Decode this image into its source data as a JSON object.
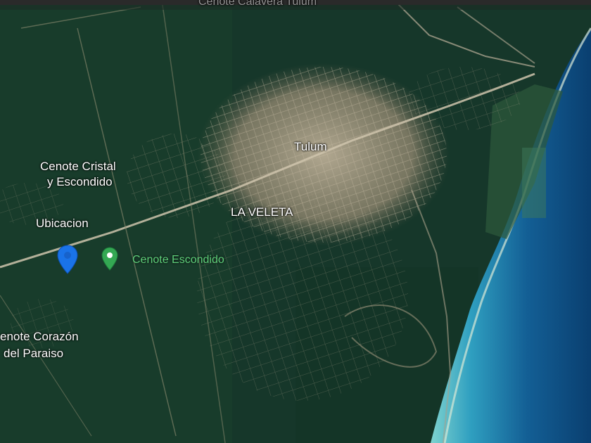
{
  "map": {
    "labels": {
      "top_partial": "Cenote Calavera Tulum",
      "tulum": "Tulum",
      "cenote_cristal_1": "Cenote Cristal",
      "cenote_cristal_2": "y Escondido",
      "la_veleta": "LA VELETA",
      "ubicacion": "Ubicacion",
      "cenote_escondido": "Cenote Escondido",
      "cenote_corazon_1": "enote Corazón",
      "cenote_corazon_2": "del Paraiso"
    },
    "pins": [
      {
        "name": "ubicacion-pin",
        "color": "#1a73e8",
        "icon": "map-pin-icon"
      },
      {
        "name": "cenote-escondido-pin",
        "color": "#34a853",
        "icon": "map-pin-icon"
      }
    ],
    "colors": {
      "land": "#173a25",
      "urban": "#a59a84",
      "sea_shallow": "#4fb5c2",
      "sea_deep": "#0d4f86"
    }
  }
}
